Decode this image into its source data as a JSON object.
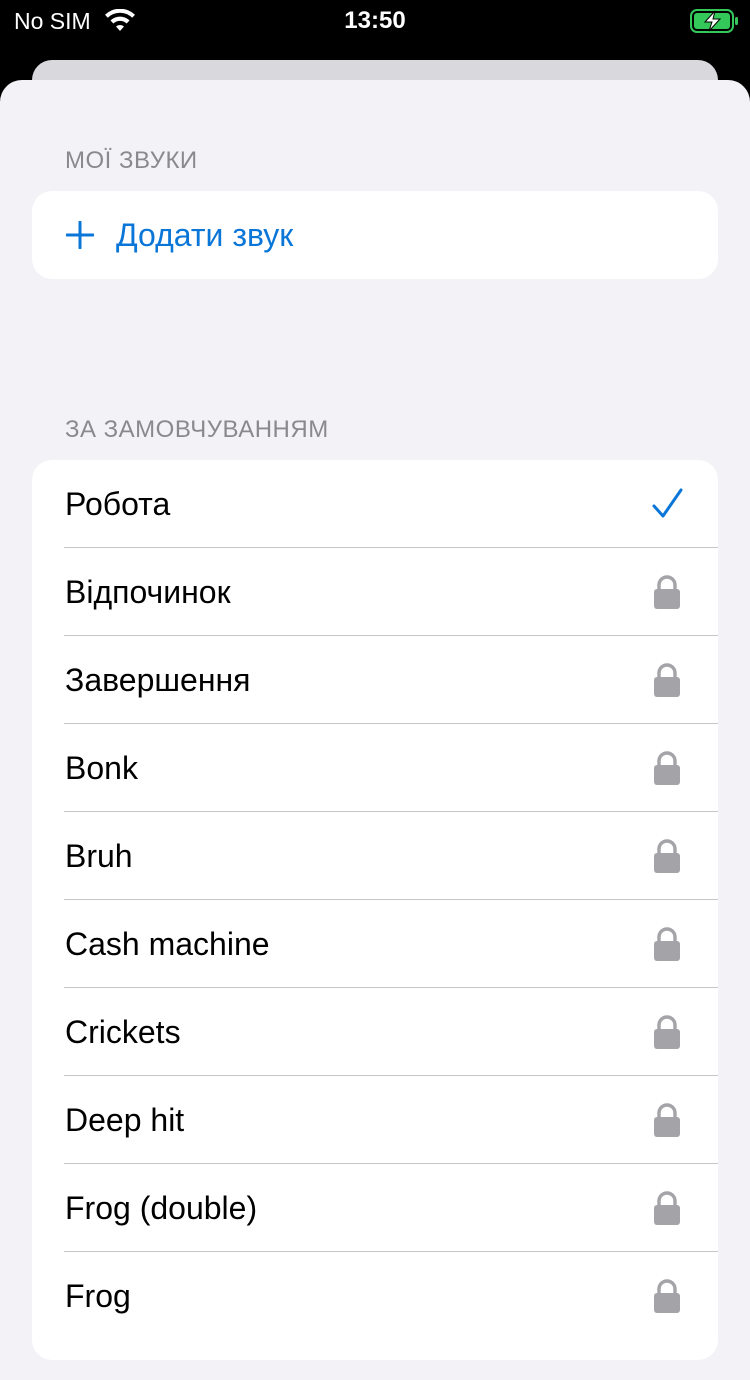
{
  "status_bar": {
    "carrier": "No SIM",
    "time": "13:50",
    "wifi_icon": "wifi-icon",
    "battery_icon": "battery-charging-icon"
  },
  "colors": {
    "accent": "#0a76d8",
    "battery": "#34c759",
    "lock": "#a3a3a8"
  },
  "my_sounds": {
    "header": "МОЇ ЗВУКИ",
    "add_label": "Додати звук",
    "add_icon": "plus-icon"
  },
  "defaults": {
    "header": "ЗА ЗАМОВЧУВАННЯМ",
    "items": [
      {
        "label": "Робота",
        "state": "selected",
        "icon": "checkmark-icon"
      },
      {
        "label": "Відпочинок",
        "state": "locked",
        "icon": "lock-icon"
      },
      {
        "label": "Завершення",
        "state": "locked",
        "icon": "lock-icon"
      },
      {
        "label": "Bonk",
        "state": "locked",
        "icon": "lock-icon"
      },
      {
        "label": "Bruh",
        "state": "locked",
        "icon": "lock-icon"
      },
      {
        "label": "Cash machine",
        "state": "locked",
        "icon": "lock-icon"
      },
      {
        "label": "Crickets",
        "state": "locked",
        "icon": "lock-icon"
      },
      {
        "label": "Deep hit",
        "state": "locked",
        "icon": "lock-icon"
      },
      {
        "label": "Frog (double)",
        "state": "locked",
        "icon": "lock-icon"
      },
      {
        "label": "Frog",
        "state": "locked",
        "icon": "lock-icon"
      }
    ]
  }
}
